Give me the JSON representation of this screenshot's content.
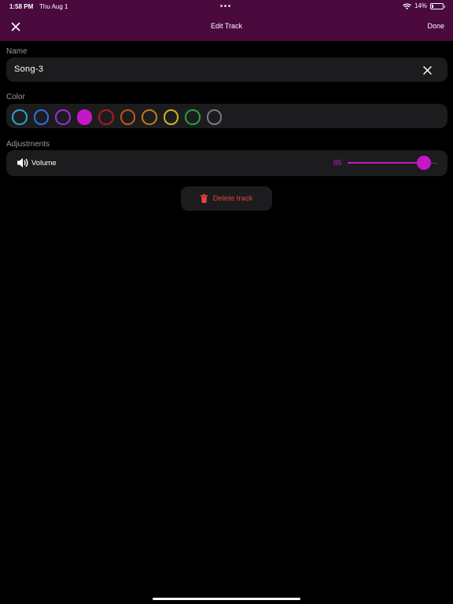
{
  "status_bar": {
    "time": "1:58 PM",
    "date": "Thu Aug 1",
    "battery_text": "14%",
    "battery_level": 0.14
  },
  "nav": {
    "title": "Edit Track",
    "done_label": "Done",
    "close_icon": "close-icon"
  },
  "name_section": {
    "label": "Name",
    "value": "Song-3",
    "clear_icon": "clear-icon"
  },
  "color_section": {
    "label": "Color",
    "swatches": [
      {
        "color": "#2aa8c8",
        "selected": false
      },
      {
        "color": "#2b74d8",
        "selected": false
      },
      {
        "color": "#9b2fd8",
        "selected": false
      },
      {
        "color": "#c418c8",
        "selected": true
      },
      {
        "color": "#b01c1c",
        "selected": false
      },
      {
        "color": "#c4541c",
        "selected": false
      },
      {
        "color": "#c47a1c",
        "selected": false
      },
      {
        "color": "#d2b21c",
        "selected": false
      },
      {
        "color": "#23a63c",
        "selected": false
      },
      {
        "color": "#7a7a7e",
        "selected": false
      }
    ]
  },
  "adjustments_section": {
    "label": "Adjustments",
    "volume": {
      "label": "Volume",
      "value": "85",
      "min": 0,
      "max": 100,
      "level": 85,
      "icon": "speaker-icon"
    }
  },
  "delete_button": {
    "label": "Delete track",
    "icon": "trash-icon"
  },
  "colors": {
    "accent": "#c418c8",
    "danger": "#e8433a",
    "header_bg": "#4a0a3e",
    "panel_bg": "#1c1c1f"
  }
}
